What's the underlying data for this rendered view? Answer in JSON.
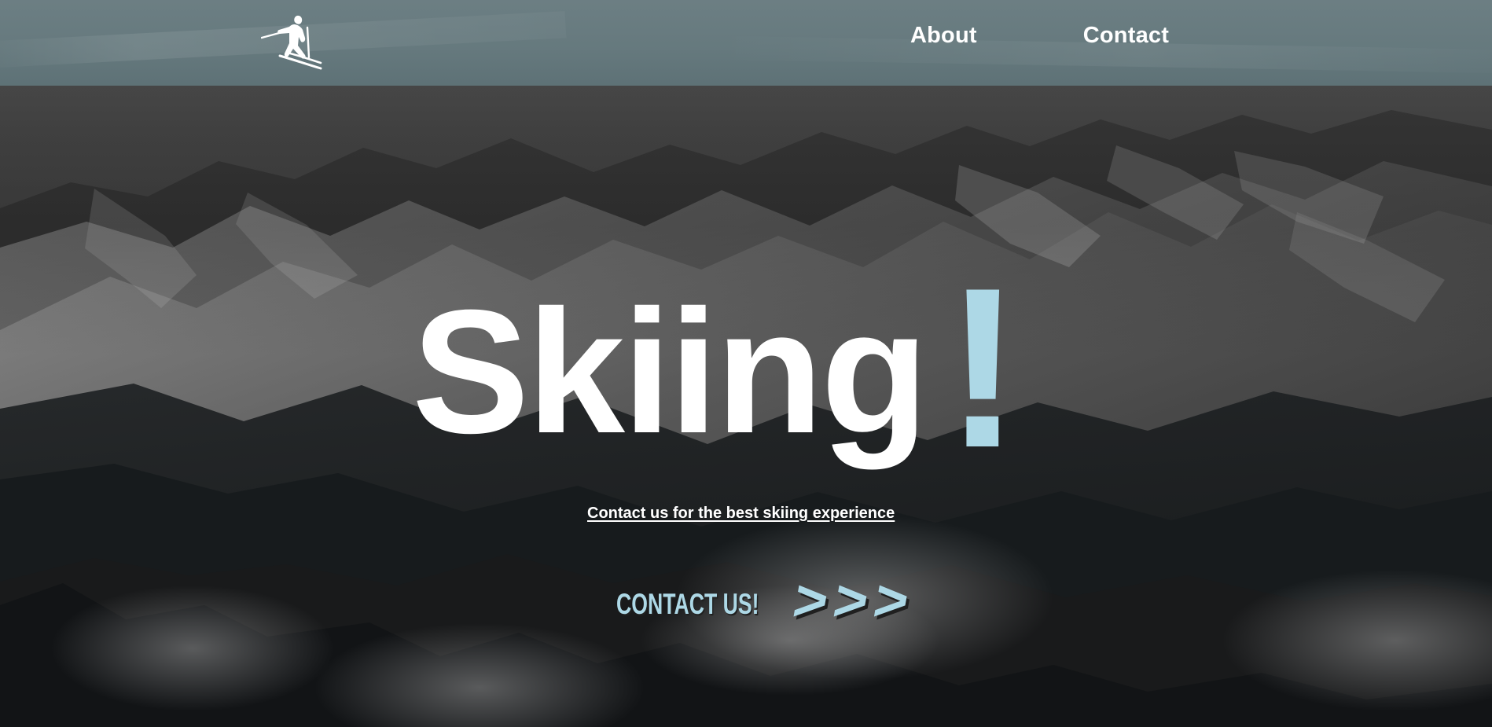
{
  "nav": {
    "items": [
      {
        "label": "About"
      },
      {
        "label": "Contact"
      }
    ]
  },
  "hero": {
    "title": "Skiing",
    "exclamation": "!",
    "subtitle": "Contact us for the best skiing experience",
    "cta_label": "CONTACT US!",
    "cta_arrows": ">>>"
  },
  "colors": {
    "accent": "#add8e6",
    "nav_bar": "#6e8287",
    "text": "#ffffff",
    "background": "#232323"
  },
  "icons": {
    "logo": "skier-icon"
  }
}
